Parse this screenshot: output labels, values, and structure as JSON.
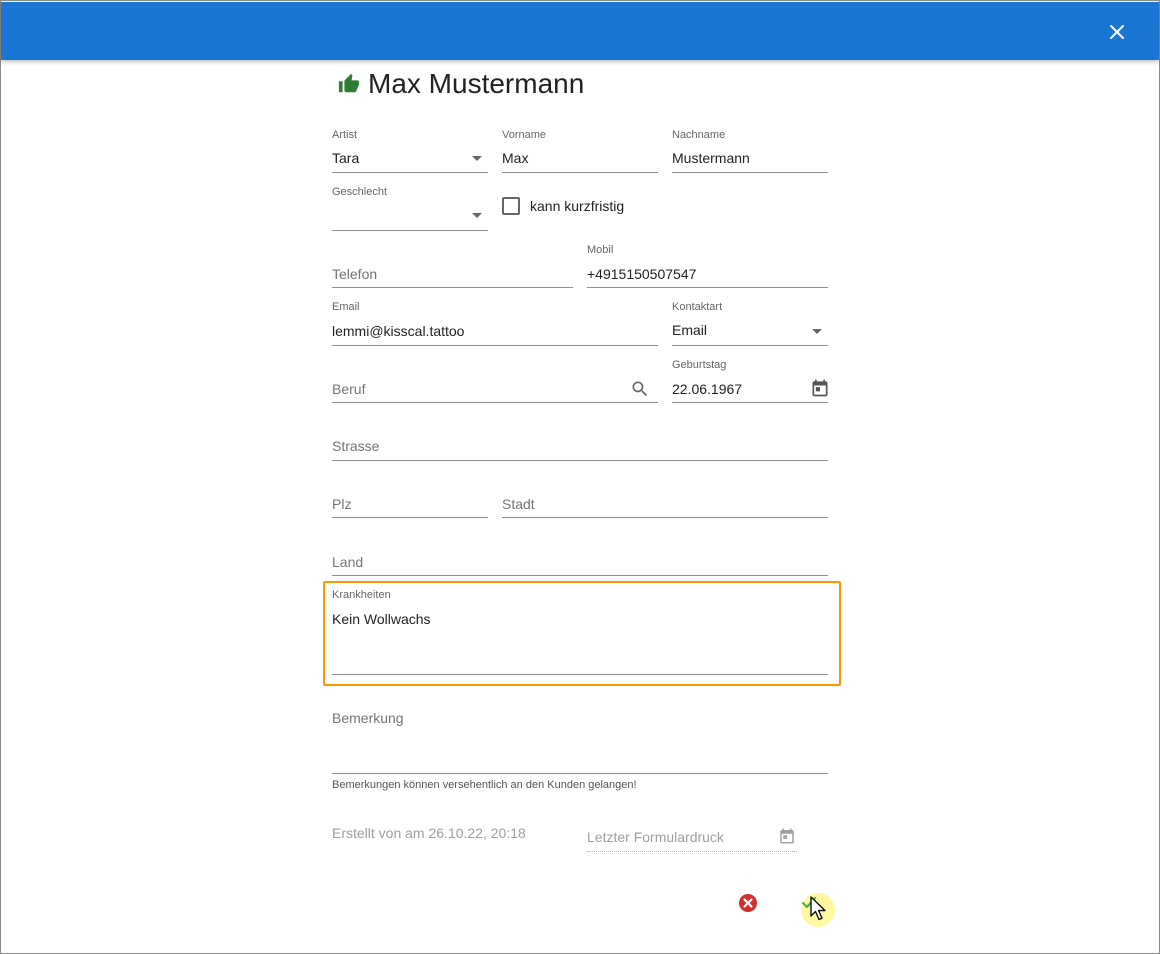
{
  "header": {
    "close_icon": "close-icon"
  },
  "title": {
    "name": "Max Mustermann",
    "icon": "thumb-up-icon",
    "icon_color": "#2e7d32"
  },
  "form": {
    "artist": {
      "label": "Artist",
      "value": "Tara"
    },
    "vorname": {
      "label": "Vorname",
      "value": "Max"
    },
    "nachname": {
      "label": "Nachname",
      "value": "Mustermann"
    },
    "geschlecht": {
      "label": "Geschlecht",
      "value": ""
    },
    "kurzfristig": {
      "label": "kann kurzfristig",
      "checked": false
    },
    "telefon": {
      "placeholder": "Telefon"
    },
    "mobil": {
      "label": "Mobil",
      "value": "+4915150507547"
    },
    "email": {
      "label": "Email",
      "value": "lemmi@kisscal.tattoo"
    },
    "kontaktart": {
      "label": "Kontaktart",
      "value": "Email"
    },
    "beruf": {
      "placeholder": "Beruf"
    },
    "geburtstag": {
      "label": "Geburtstag",
      "value": "22.06.1967"
    },
    "strasse": {
      "placeholder": "Strasse"
    },
    "plz": {
      "placeholder": "Plz"
    },
    "stadt": {
      "placeholder": "Stadt"
    },
    "land": {
      "placeholder": "Land"
    },
    "krankheiten": {
      "label": "Krankheiten",
      "value": "Kein Wollwachs"
    },
    "bemerkung": {
      "placeholder": "Bemerkung",
      "hint": "Bemerkungen können versehentlich an den Kunden gelangen!"
    },
    "erstellt": {
      "text": "Erstellt von am 26.10.22, 20:18"
    },
    "formulardruck": {
      "placeholder": "Letzter Formulardruck"
    }
  },
  "colors": {
    "primary": "#1976d2",
    "highlight": "#ff9800",
    "cancel": "#d32f2f",
    "save": "#4caf50"
  },
  "actions": {
    "cancel_icon": "cancel-icon",
    "save_icon": "check-icon"
  }
}
